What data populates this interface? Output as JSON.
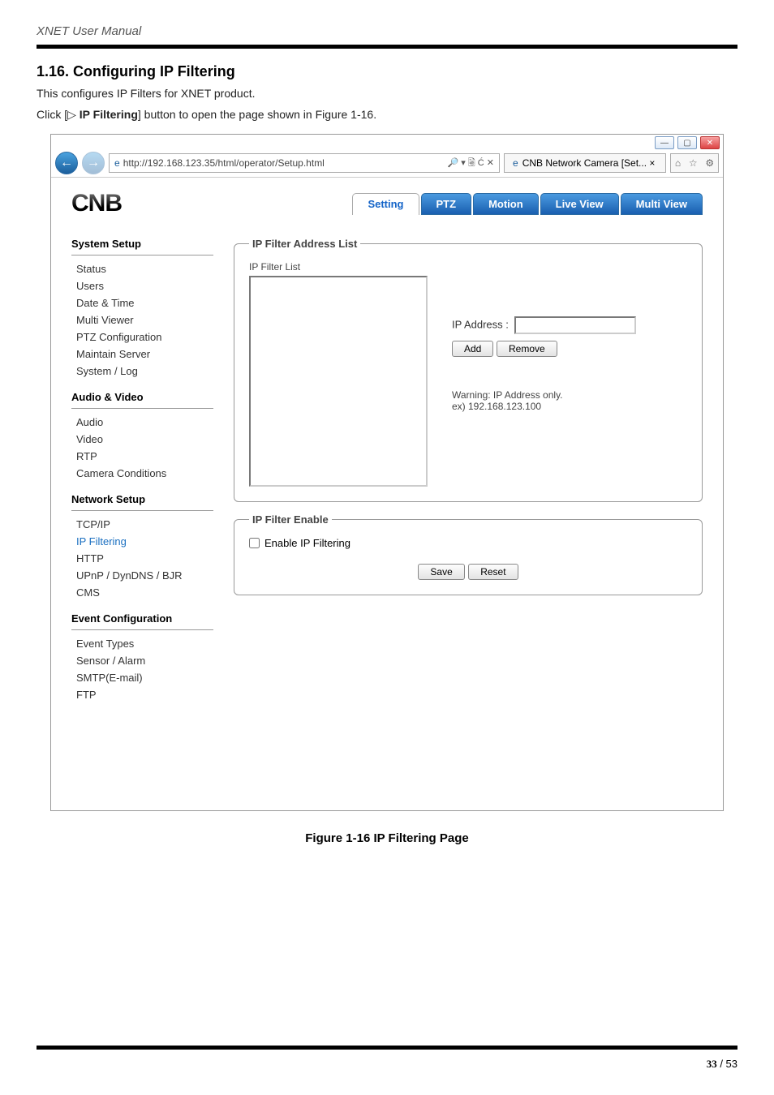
{
  "doc": {
    "manual_header": "XNET User Manual",
    "section_heading": "1.16. Configuring IP Filtering",
    "desc": "This configures IP Filters for XNET product.",
    "instruction_prefix": "Click [▷ ",
    "instruction_bold": "IP Filtering",
    "instruction_suffix": "] button to open the page shown in Figure 1-16.",
    "figure_caption": "Figure 1-16 IP Filtering Page",
    "page_num_bold": "33",
    "page_num_total": " / 53"
  },
  "browser": {
    "url": "http://192.168.123.35/html/operator/Setup.html",
    "url_suffix": " 🔎 ▾ 🗟 Ć ✕",
    "tab_title": "CNB Network Camera [Set... ×"
  },
  "logo": "CNB",
  "tabs": {
    "setting": "Setting",
    "ptz": "PTZ",
    "motion": "Motion",
    "liveview": "Live View",
    "multiview": "Multi View"
  },
  "sidebar": {
    "g1": "System Setup",
    "g1_items": {
      "status": "Status",
      "users": "Users",
      "datetime": "Date & Time",
      "multiviewer": "Multi Viewer",
      "ptzconf": "PTZ Configuration",
      "maintain": "Maintain Server",
      "syslog": "System / Log"
    },
    "g2": "Audio & Video",
    "g2_items": {
      "audio": "Audio",
      "video": "Video",
      "rtp": "RTP",
      "camcond": "Camera Conditions"
    },
    "g3": "Network Setup",
    "g3_items": {
      "tcpip": "TCP/IP",
      "ipfilter": "IP Filtering",
      "http": "HTTP",
      "upnp": "UPnP / DynDNS / BJR",
      "cms": "CMS"
    },
    "g4": "Event Configuration",
    "g4_items": {
      "evt": "Event Types",
      "sensor": "Sensor / Alarm",
      "smtp": "SMTP(E-mail)",
      "ftp": "FTP"
    }
  },
  "panel": {
    "legend_list": "IP Filter Address List",
    "list_label": "IP Filter List",
    "ipaddr_label": "IP Address :",
    "add": "Add",
    "remove": "Remove",
    "warn1": "Warning: IP Address only.",
    "warn2": "ex) 192.168.123.100",
    "legend_enable": "IP Filter Enable",
    "enable_label": "Enable IP Filtering",
    "save": "Save",
    "reset": "Reset"
  }
}
